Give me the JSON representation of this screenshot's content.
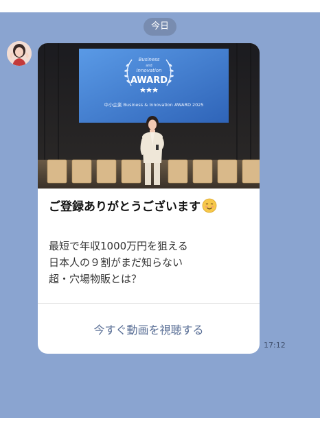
{
  "chat": {
    "date_label": "今日",
    "timestamp": "17:12"
  },
  "photo": {
    "script_line_1": "Business",
    "script_line_2": "and",
    "script_line_3": "Innovation",
    "award_text": "AWARD",
    "subtitle": "中小企業 Business & Innovation AWARD 2025"
  },
  "message": {
    "title": "ご登録ありがとうございます",
    "title_emoji": "relieved-smiling-face",
    "body_lines": [
      "最短で年収1000万円を狙える",
      "日本人の９割がまだ知らない",
      "超・穴場物販とは？"
    ],
    "cta_label": "今すぐ動画を視聴する"
  },
  "colors": {
    "chat_background": "#8aa4d0",
    "cta_text": "#5a6f96",
    "screen_blue": "#3f7fd1"
  }
}
